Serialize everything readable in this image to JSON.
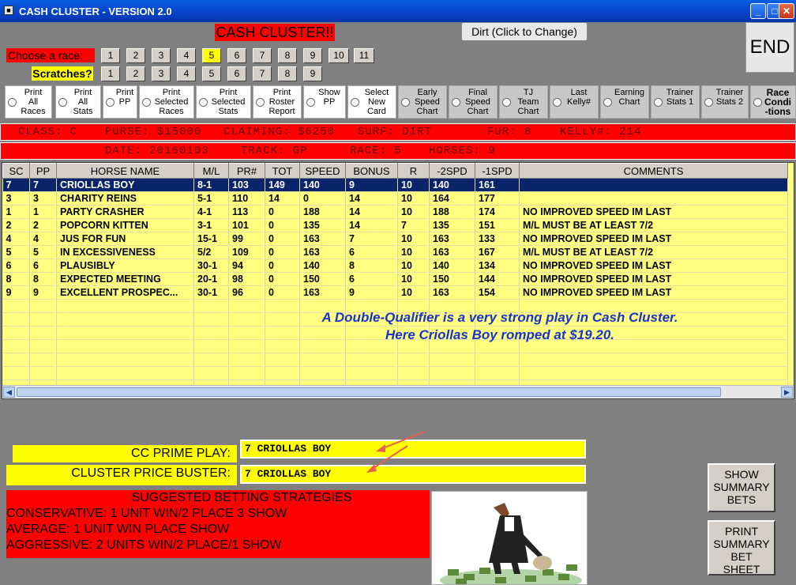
{
  "window": {
    "title": "CASH CLUSTER - VERSION 2.0",
    "min": "_",
    "max": "□",
    "close": "✕"
  },
  "header": {
    "app_label": "CASH CLUSTER!!",
    "surface_button": "Dirt (Click to Change)",
    "end_button": "END"
  },
  "race_select": {
    "label": "Choose  a race:",
    "numbers": [
      "1",
      "2",
      "3",
      "4",
      "5",
      "6",
      "7",
      "8",
      "9",
      "10",
      "11"
    ],
    "selected": "5"
  },
  "scratches": {
    "label": "Scratches?",
    "numbers": [
      "1",
      "2",
      "3",
      "4",
      "5",
      "6",
      "7",
      "8",
      "9"
    ]
  },
  "options": [
    "Print\nAll\nRaces",
    "Print\nAll\nStats",
    "Print\nPP",
    "Print\nSelected\nRaces",
    "Print\nSelected\nStats",
    "Print\nRoster\nReport",
    "Show\nPP",
    "Select\nNew\nCard",
    "Early\nSpeed\nChart",
    "Final\nSpeed\nChart",
    "TJ\nTeam\nChart",
    "Last\nKelly#",
    "Earning\nChart",
    "Trainer\nStats 1",
    "Trainer\nStats 2",
    "Race\nCondi\n-tions"
  ],
  "info1": {
    "class": "CLASS: C",
    "purse": "PURSE: $15000",
    "claiming": "CLAIMING: $6250",
    "surf": "SURF: DIRT",
    "fur": "FUR: 8",
    "kelly": "KELLY#: 214"
  },
  "info2": {
    "date": "DATE: 20160103",
    "track": "TRACK: GP",
    "race": "RACE: 5",
    "horses": "HORSES: 9"
  },
  "grid": {
    "columns": [
      "SC",
      "PP",
      "HORSE NAME",
      "M/L",
      "PR#",
      "TOT",
      "SPEED",
      "BONUS",
      "R",
      "-2SPD",
      "-1SPD",
      "COMMENTS"
    ],
    "rows": [
      [
        "7",
        "7",
        "CRIOLLAS BOY",
        "8-1",
        "103",
        "149",
        "140",
        "9",
        "10",
        "140",
        "161",
        ""
      ],
      [
        "3",
        "3",
        "CHARITY REINS",
        "5-1",
        "110",
        "14",
        "0",
        "14",
        "10",
        "164",
        "177",
        ""
      ],
      [
        "1",
        "1",
        "PARTY CRASHER",
        "4-1",
        "113",
        "0",
        "188",
        "14",
        "10",
        "188",
        "174",
        "NO IMPROVED SPEED IM LAST"
      ],
      [
        "2",
        "2",
        "POPCORN KITTEN",
        "3-1",
        "101",
        "0",
        "135",
        "14",
        "7",
        "135",
        "151",
        "M/L MUST BE AT LEAST 7/2"
      ],
      [
        "4",
        "4",
        "JUS FOR FUN",
        "15-1",
        "99",
        "0",
        "163",
        "7",
        "10",
        "163",
        "133",
        "NO IMPROVED SPEED IM LAST"
      ],
      [
        "5",
        "5",
        "IN EXCESSIVENESS",
        "5/2",
        "109",
        "0",
        "163",
        "6",
        "10",
        "163",
        "167",
        "M/L MUST BE AT LEAST 7/2"
      ],
      [
        "6",
        "6",
        "PLAUSIBLY",
        "30-1",
        "94",
        "0",
        "140",
        "8",
        "10",
        "140",
        "134",
        "NO IMPROVED SPEED IM LAST"
      ],
      [
        "8",
        "8",
        "EXPECTED MEETING",
        "20-1",
        "98",
        "0",
        "150",
        "6",
        "10",
        "150",
        "144",
        "NO IMPROVED SPEED IM LAST"
      ],
      [
        "9",
        "9",
        "EXCELLENT PROSPEC...",
        "30-1",
        "96",
        "0",
        "163",
        "9",
        "10",
        "163",
        "154",
        "NO IMPROVED SPEED IM LAST"
      ]
    ],
    "selected_row": 0
  },
  "note": {
    "line1": "A Double-Qualifier is a very strong play in Cash Cluster.",
    "line2": "Here Criollas Boy romped at $19.20."
  },
  "plays": {
    "prime_label": "CC PRIME PLAY:",
    "prime_value": "7  CRIOLLAS BOY",
    "buster_label": "CLUSTER PRICE BUSTER:",
    "buster_value": "7  CRIOLLAS BOY"
  },
  "strategies": {
    "title": "SUGGESTED BETTING STRATEGIES",
    "lines": [
      "CONSERVATIVE: 1 UNIT WIN/2 PLACE 3 SHOW",
      "AVERAGE: 1 UNIT WIN PLACE SHOW",
      "AGGRESSIVE: 2 UNITS WIN/2 PLACE/1 SHOW"
    ]
  },
  "side_buttons": {
    "show_summary": "SHOW\nSUMMARY\nBETS",
    "print_summary": "PRINT\nSUMMARY\nBET\nSHEET"
  },
  "colors": {
    "accent_red": "#ff0000",
    "accent_yellow": "#ffff00",
    "note_blue": "#1a33cc",
    "selected_row": "#0a246a"
  }
}
